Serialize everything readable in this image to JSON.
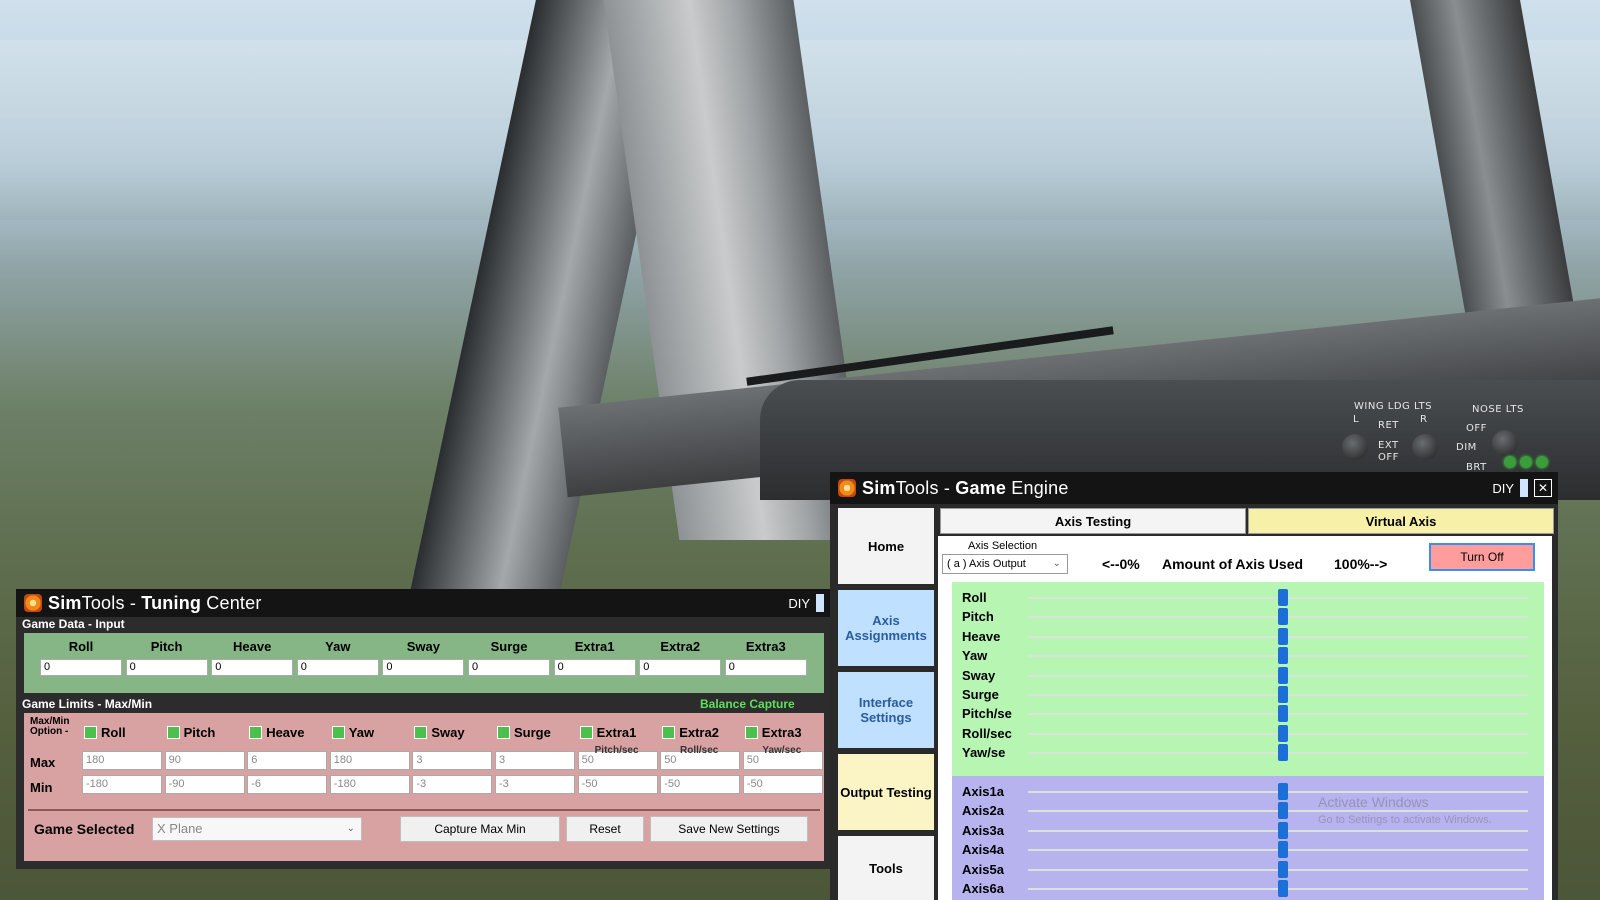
{
  "cockpit": {
    "panel_labels": [
      "WING LDG LTS",
      "NOSE LTS",
      "L",
      "R",
      "RET",
      "EXT",
      "OFF",
      "OFF",
      "DIM",
      "BRT"
    ]
  },
  "tuning_center": {
    "title_prefix": "Sim",
    "title_mid": "Tools - ",
    "title_bold": "Tuning",
    "title_suffix": " Center",
    "diy": "DIY",
    "game_data_header": "Game Data - Input",
    "axes": [
      "Roll",
      "Pitch",
      "Heave",
      "Yaw",
      "Sway",
      "Surge",
      "Extra1",
      "Extra2",
      "Extra3"
    ],
    "inputs": [
      "0",
      "0",
      "0",
      "0",
      "0",
      "0",
      "0",
      "0",
      "0"
    ],
    "game_limits_header": "Game Limits - Max/Min",
    "balance_capture": "Balance Capture",
    "max_min_option": "Max/Min\nOption -",
    "sub_labels": [
      "Pitch/sec",
      "Roll/sec",
      "Yaw/sec"
    ],
    "max_label": "Max",
    "min_label": "Min",
    "max_values": [
      "180",
      "90",
      "6",
      "180",
      "3",
      "3",
      "50",
      "50",
      "50"
    ],
    "min_values": [
      "-180",
      "-90",
      "-6",
      "-180",
      "-3",
      "-3",
      "-50",
      "-50",
      "-50"
    ],
    "game_selected_label": "Game Selected",
    "game_selected_value": "X Plane",
    "buttons": {
      "capture": "Capture Max Min",
      "reset": "Reset",
      "save": "Save New Settings"
    }
  },
  "game_engine": {
    "title_prefix": "Sim",
    "title_mid": "Tools - ",
    "title_bold": "Game",
    "title_suffix": " Engine",
    "diy": "DIY",
    "sidebar": [
      "Home",
      "Axis Assignments",
      "Interface Settings",
      "Output Testing",
      "Tools"
    ],
    "tabs": [
      "Axis Testing",
      "Virtual Axis"
    ],
    "axis_selection_label": "Axis Selection",
    "axis_selection_value": "( a ) Axis Output",
    "amount_left": "<--0%",
    "amount_mid": "Amount of Axis Used",
    "amount_right": "100%-->",
    "turn_off": "Turn Off",
    "dof_axes": [
      "Roll",
      "Pitch",
      "Heave",
      "Yaw",
      "Sway",
      "Surge",
      "Pitch/se",
      "Roll/sec",
      "Yaw/se"
    ],
    "output_axes": [
      "Axis1a",
      "Axis2a",
      "Axis3a",
      "Axis4a",
      "Axis5a",
      "Axis6a"
    ],
    "watermark_title": "Activate Windows",
    "watermark_sub": "Go to Settings to activate Windows.",
    "colors": {
      "dof_bg": "#b6f5b2",
      "axis_bg": "#b7b3ee",
      "thumb": "#1d6fd8"
    }
  }
}
